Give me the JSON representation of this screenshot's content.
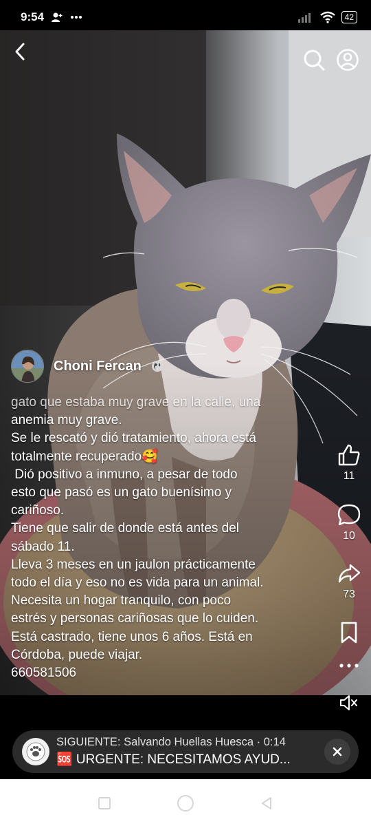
{
  "status_bar": {
    "time": "9:54",
    "battery": "42",
    "icons": [
      "person-add-icon",
      "more-dots-icon",
      "signal-icon",
      "wifi-icon",
      "battery-icon"
    ]
  },
  "header": {
    "back_icon": "back-arrow-icon",
    "search_icon": "search-icon",
    "profile_icon": "profile-icon"
  },
  "post": {
    "author": "Choni Fercan",
    "privacy_icon": "globe-icon",
    "caption_lines": [
      "gato que estaba muy grave en la calle, una",
      "anemia muy grave.",
      "Se le rescató y dió tratamiento, ahora está",
      "totalmente recuperado🥰",
      " Dió positivo a inmuno, a pesar de todo",
      "esto que pasó es un gato buenísimo y",
      "cariñoso.",
      "Tiene que salir de donde está antes del",
      "sábado 11.",
      "Lleva 3 meses en un jaulon prácticamente",
      "todo el día y eso no es vida para un animal.",
      "Necesita un hogar tranquilo, con poco",
      "estrés y personas cariñosas que lo cuiden.",
      "Está castrado, tiene unos 6 años. Está en",
      "Córdoba, puede viajar.",
      "660581506"
    ]
  },
  "actions": {
    "likes": "11",
    "comments": "10",
    "shares": "73",
    "icons": [
      "like-icon",
      "comment-icon",
      "share-icon",
      "bookmark-icon",
      "more-icon",
      "mute-icon"
    ]
  },
  "next_video": {
    "line1": "SIGUIENTE: Salvando Huellas Huesca · 0:14",
    "line2": "🆘 URGENTE: NECESITAMOS AYUD..."
  },
  "colors": {
    "background": "#000000",
    "card": "#2b2b2b",
    "text": "#ffffff"
  }
}
